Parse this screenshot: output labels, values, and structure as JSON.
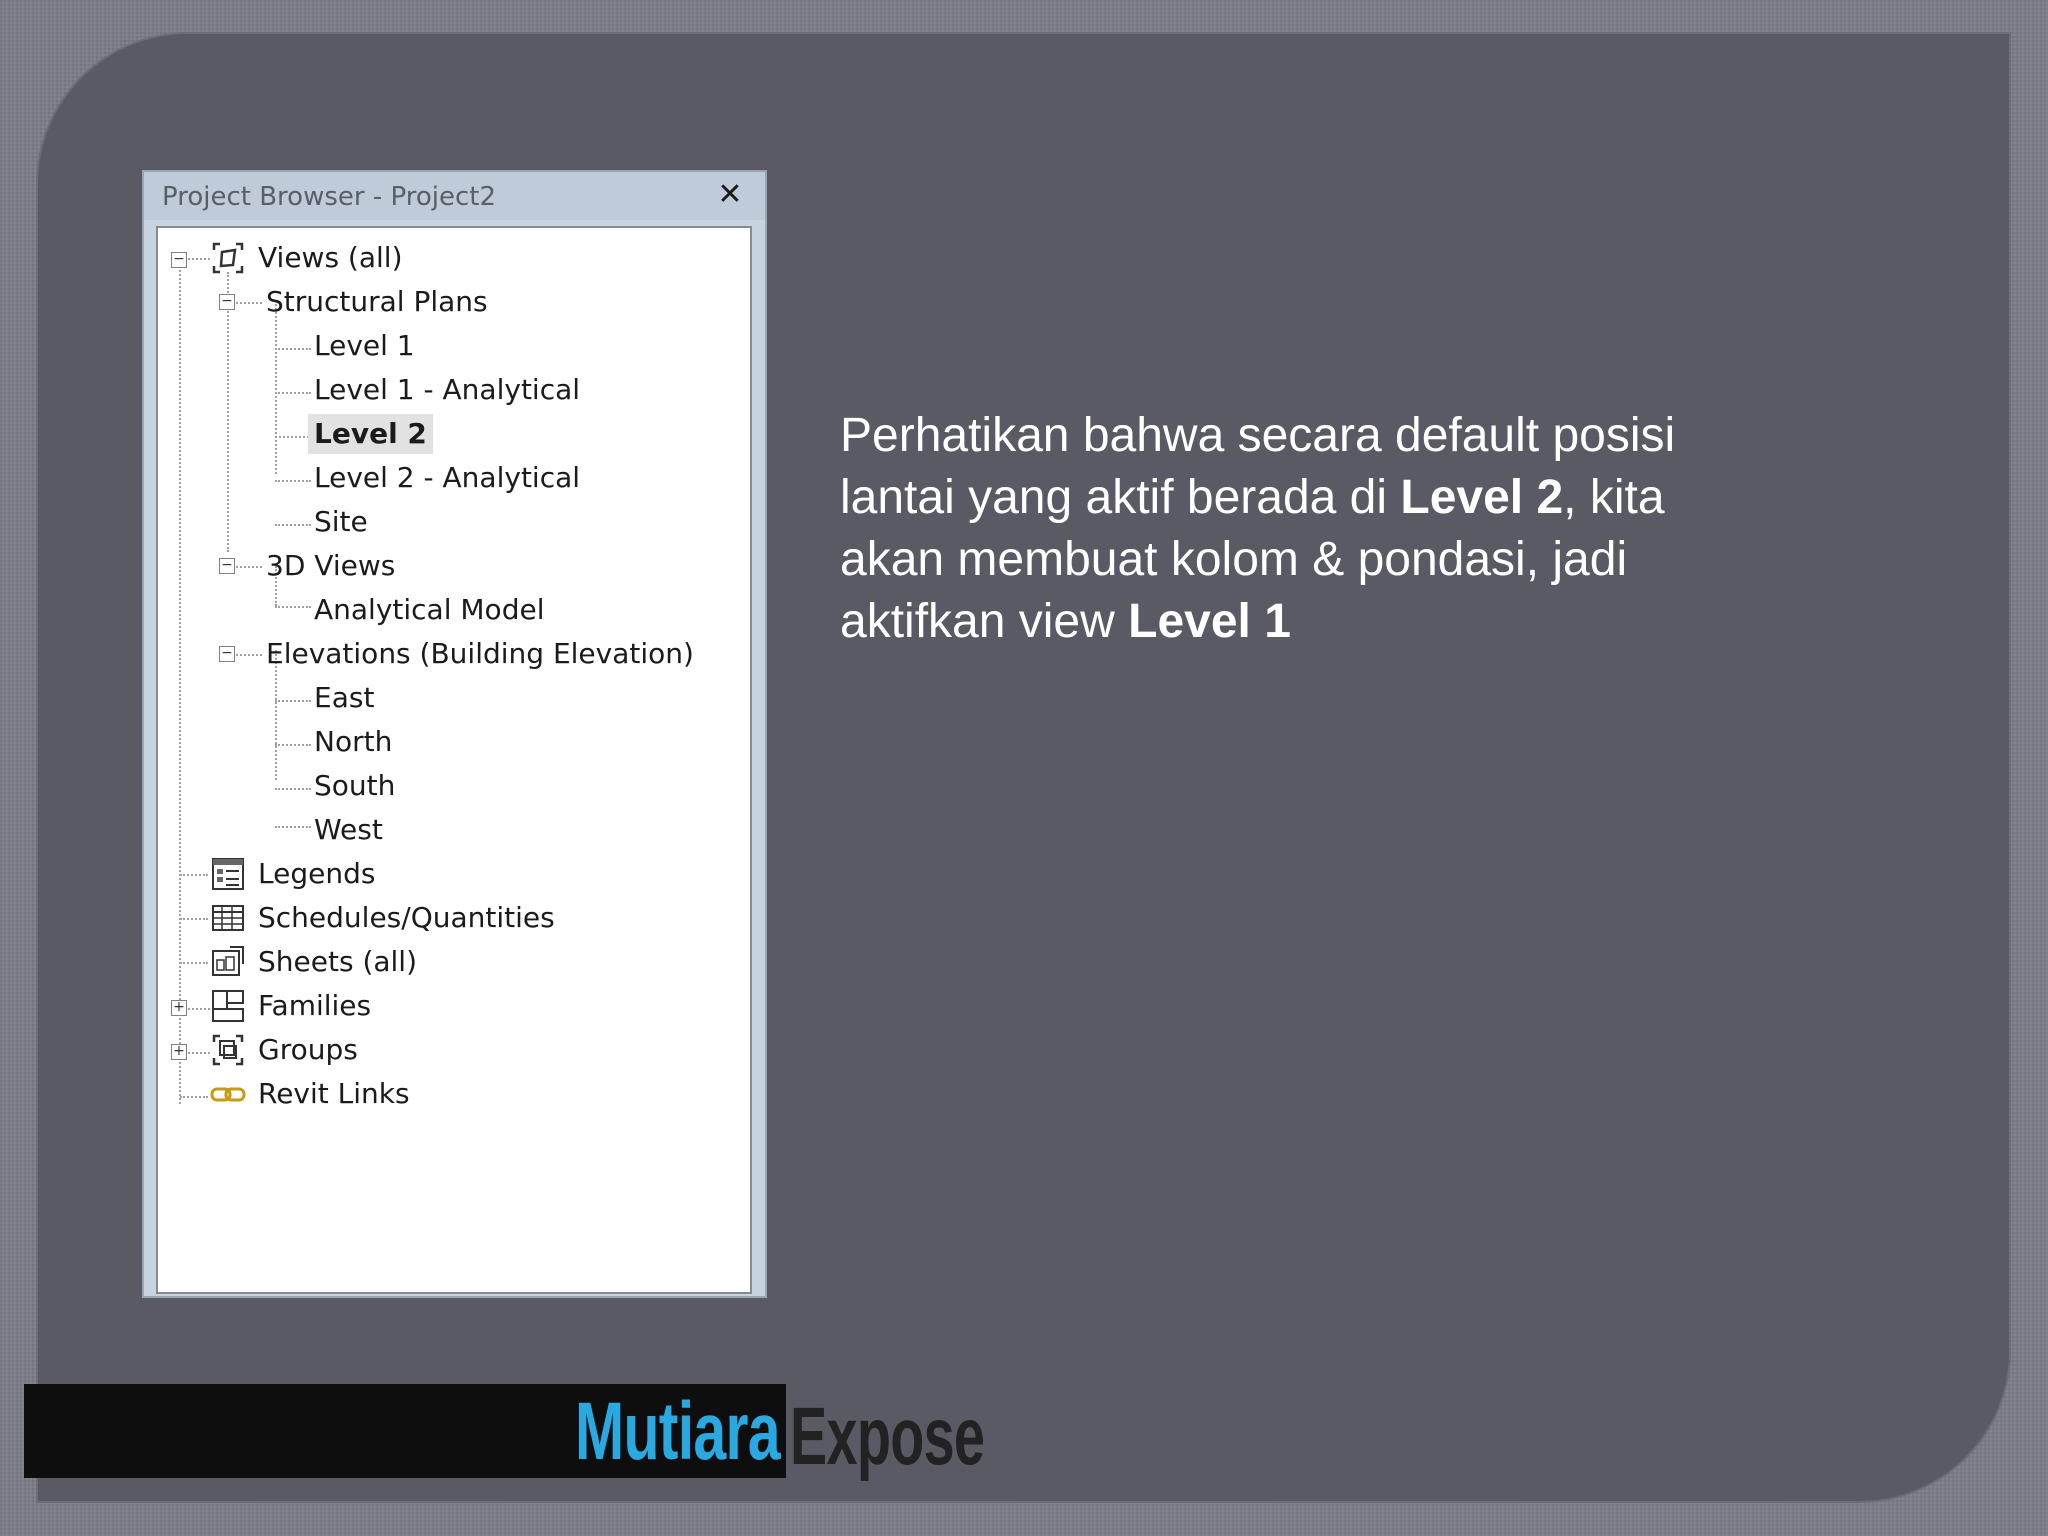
{
  "project_browser": {
    "title": "Project Browser - Project2",
    "close_label": "✕",
    "tree": {
      "views_all": "Views (all)",
      "structural_plans": "Structural Plans",
      "level1": "Level 1",
      "level1_analytical": "Level 1 - Analytical",
      "level2": "Level 2",
      "level2_analytical": "Level 2 - Analytical",
      "site": "Site",
      "views_3d": "3D Views",
      "analytical_model": "Analytical Model",
      "elevations": "Elevations (Building Elevation)",
      "east": "East",
      "north": "North",
      "south": "South",
      "west": "West",
      "legends": "Legends",
      "schedules": "Schedules/Quantities",
      "sheets_all": "Sheets (all)",
      "families": "Families",
      "groups": "Groups",
      "revit_links": "Revit Links"
    },
    "selected_item": "Level 2"
  },
  "slide_text": {
    "part1": "Perhatikan bahwa secara default posisi lantai yang aktif berada di ",
    "bold1": "Level 2",
    "part2": ", kita akan membuat kolom & pondasi, jadi aktifkan view ",
    "bold2": "Level 1"
  },
  "logo": {
    "word1": "Mutiara",
    "word2": "Expose"
  },
  "colors": {
    "background": "#7a7c87",
    "panel": "#595a63",
    "logo_blue": "#2aa8e0"
  }
}
